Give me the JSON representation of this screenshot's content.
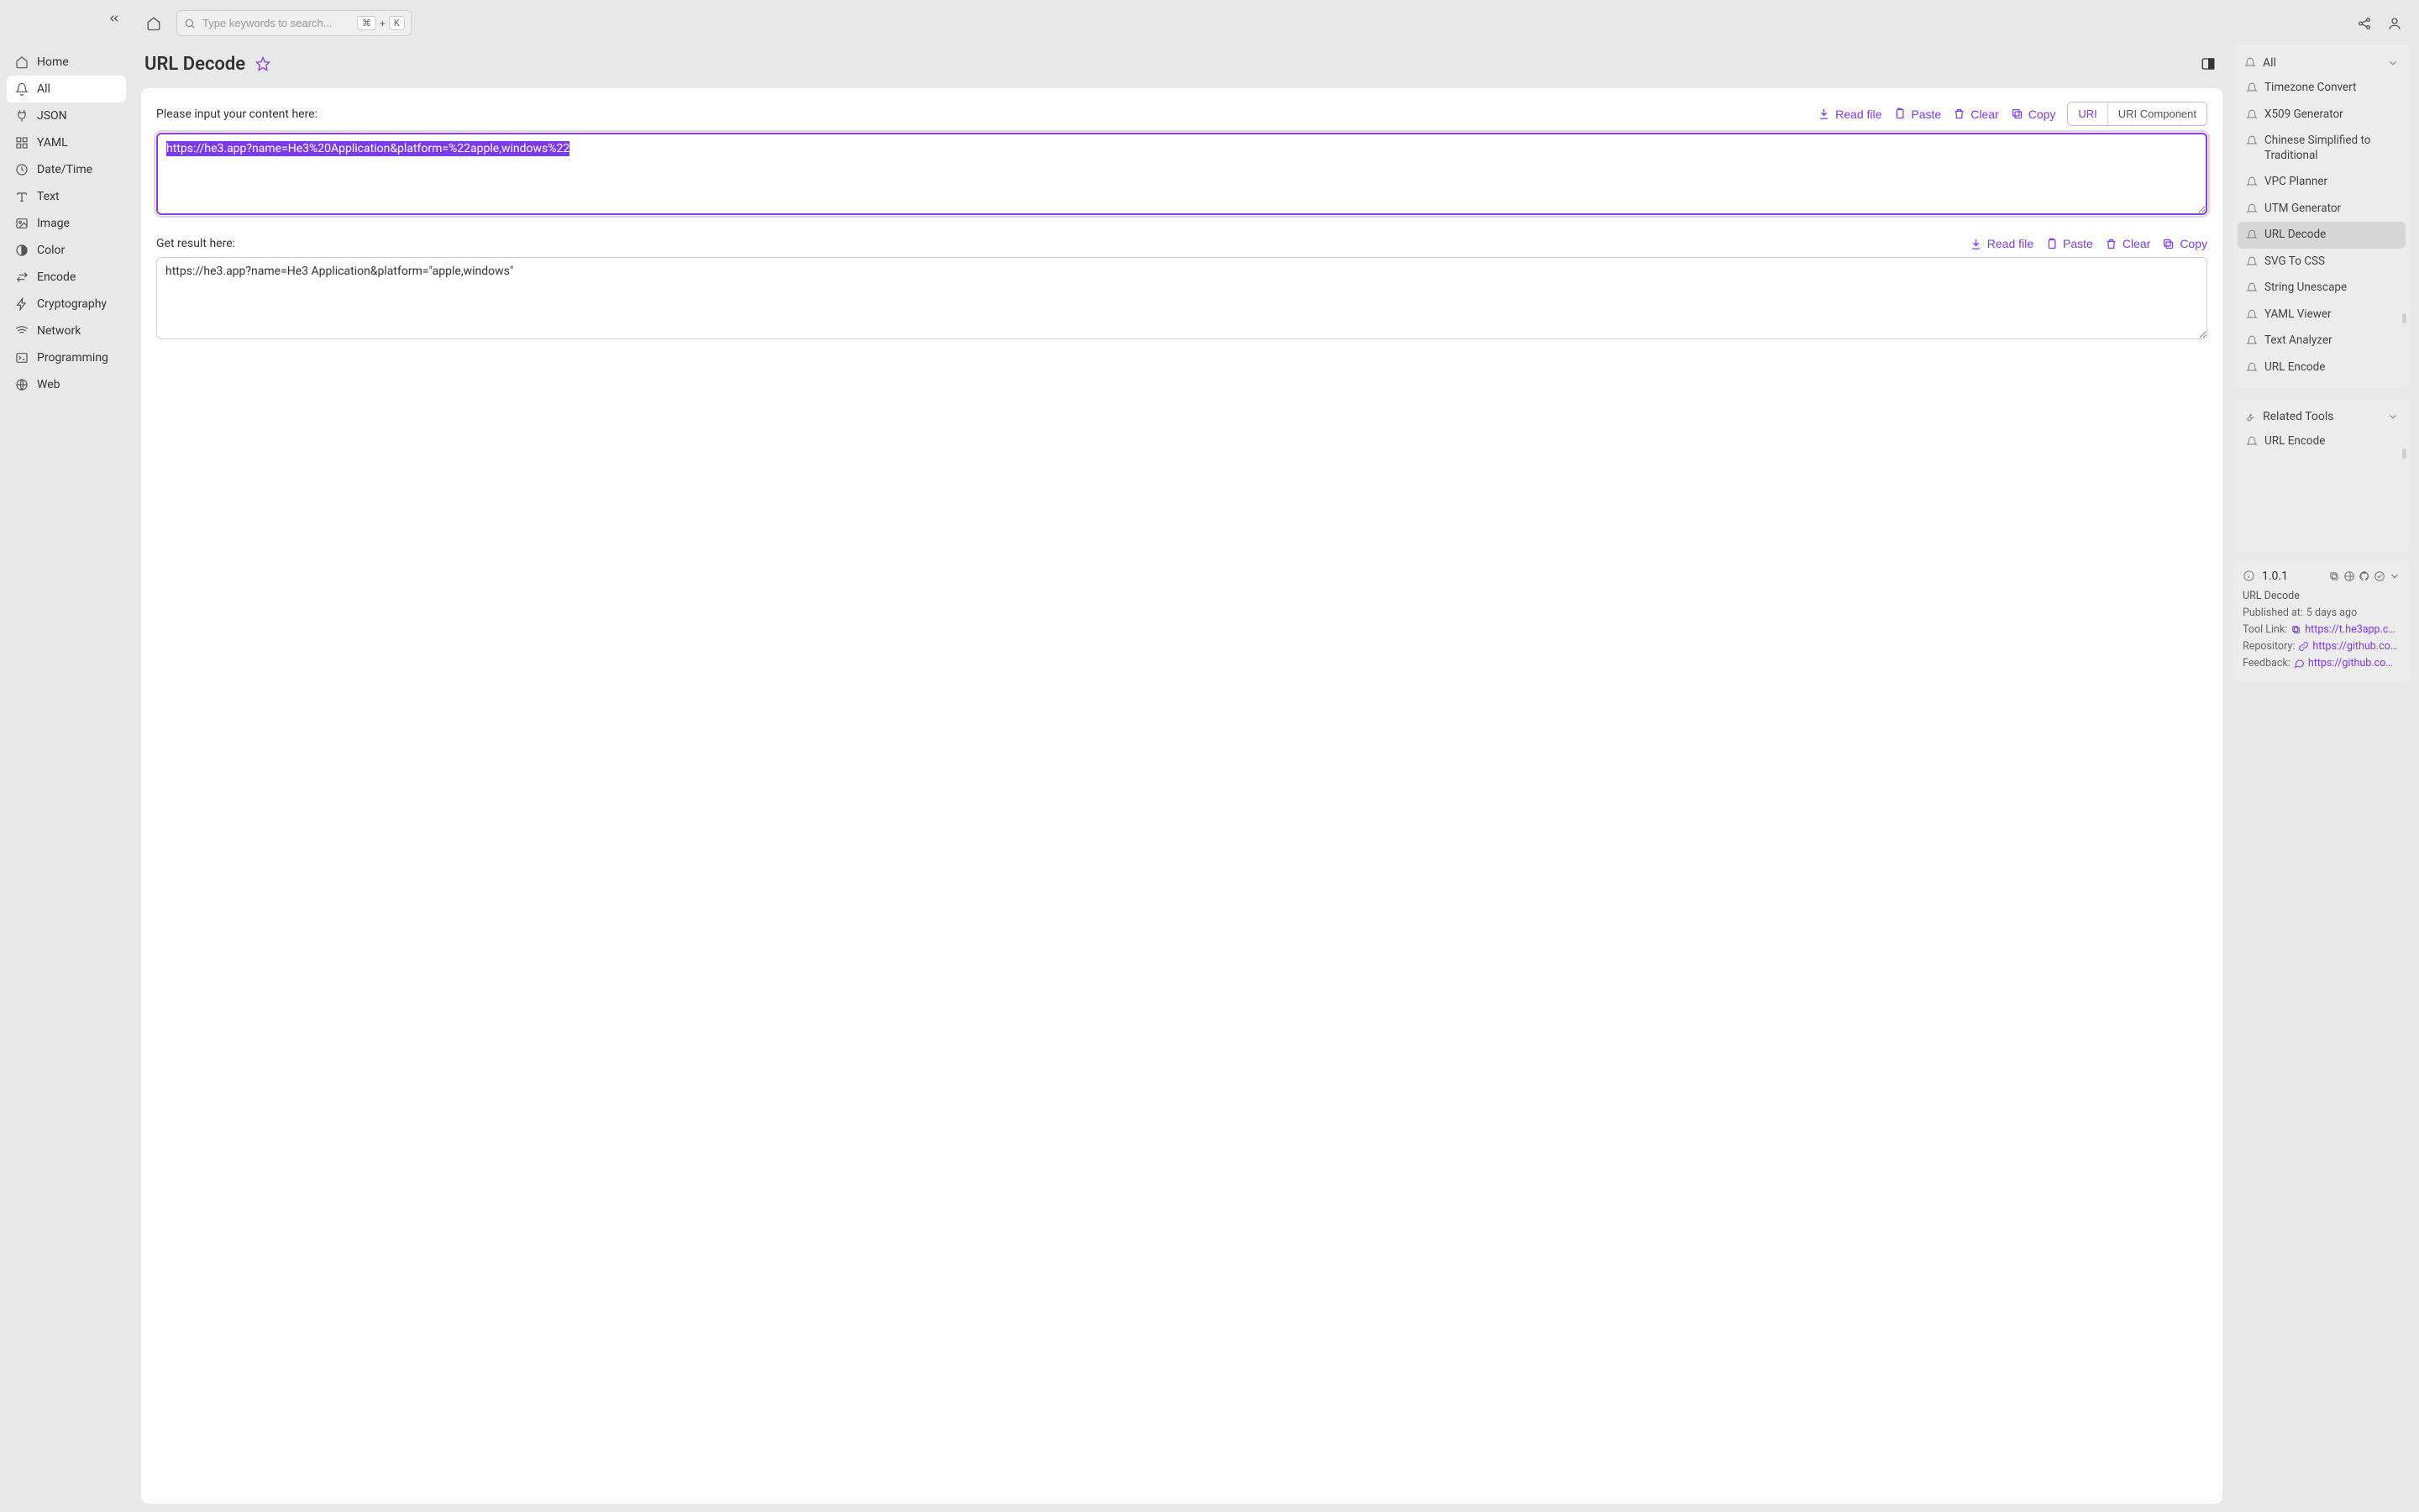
{
  "search": {
    "placeholder": "Type keywords to search...",
    "kbd1": "⌘",
    "plus": "+",
    "kbd2": "K"
  },
  "sidebar": {
    "items": [
      {
        "label": "Home"
      },
      {
        "label": "All"
      },
      {
        "label": "JSON"
      },
      {
        "label": "YAML"
      },
      {
        "label": "Date/Time"
      },
      {
        "label": "Text"
      },
      {
        "label": "Image"
      },
      {
        "label": "Color"
      },
      {
        "label": "Encode"
      },
      {
        "label": "Cryptography"
      },
      {
        "label": "Network"
      },
      {
        "label": "Programming"
      },
      {
        "label": "Web"
      }
    ]
  },
  "page": {
    "title": "URL Decode",
    "input_label": "Please input your content here:",
    "output_label": "Get result here:",
    "input_value": "https://he3.app?name=He3%20Application&platform=%22apple,windows%22",
    "output_value": "https://he3.app?name=He3 Application&platform=\"apple,windows\"",
    "actions": {
      "read_file": "Read file",
      "paste": "Paste",
      "clear": "Clear",
      "copy": "Copy"
    },
    "mode": {
      "uri": "URI",
      "uri_component": "URI Component"
    }
  },
  "right": {
    "all_header": "All",
    "all_items": [
      "Timezone Convert",
      "X509 Generator",
      "Chinese Simplified to Traditional",
      "VPC Planner",
      "UTM Generator",
      "URL Decode",
      "SVG To CSS",
      "String Unescape",
      "YAML Viewer",
      "Text Analyzer",
      "URL Encode"
    ],
    "all_active_index": 5,
    "related_header": "Related Tools",
    "related_items": [
      "URL Encode"
    ]
  },
  "info": {
    "version": "1.0.1",
    "name": "URL Decode",
    "published_label": "Published at:",
    "published_value": "5 days ago",
    "tool_link_label": "Tool Link:",
    "tool_link_value": "https://t.he3app.co…",
    "repo_label": "Repository:",
    "repo_value": "https://github.com…",
    "feedback_label": "Feedback:",
    "feedback_value": "https://github.com/…"
  }
}
